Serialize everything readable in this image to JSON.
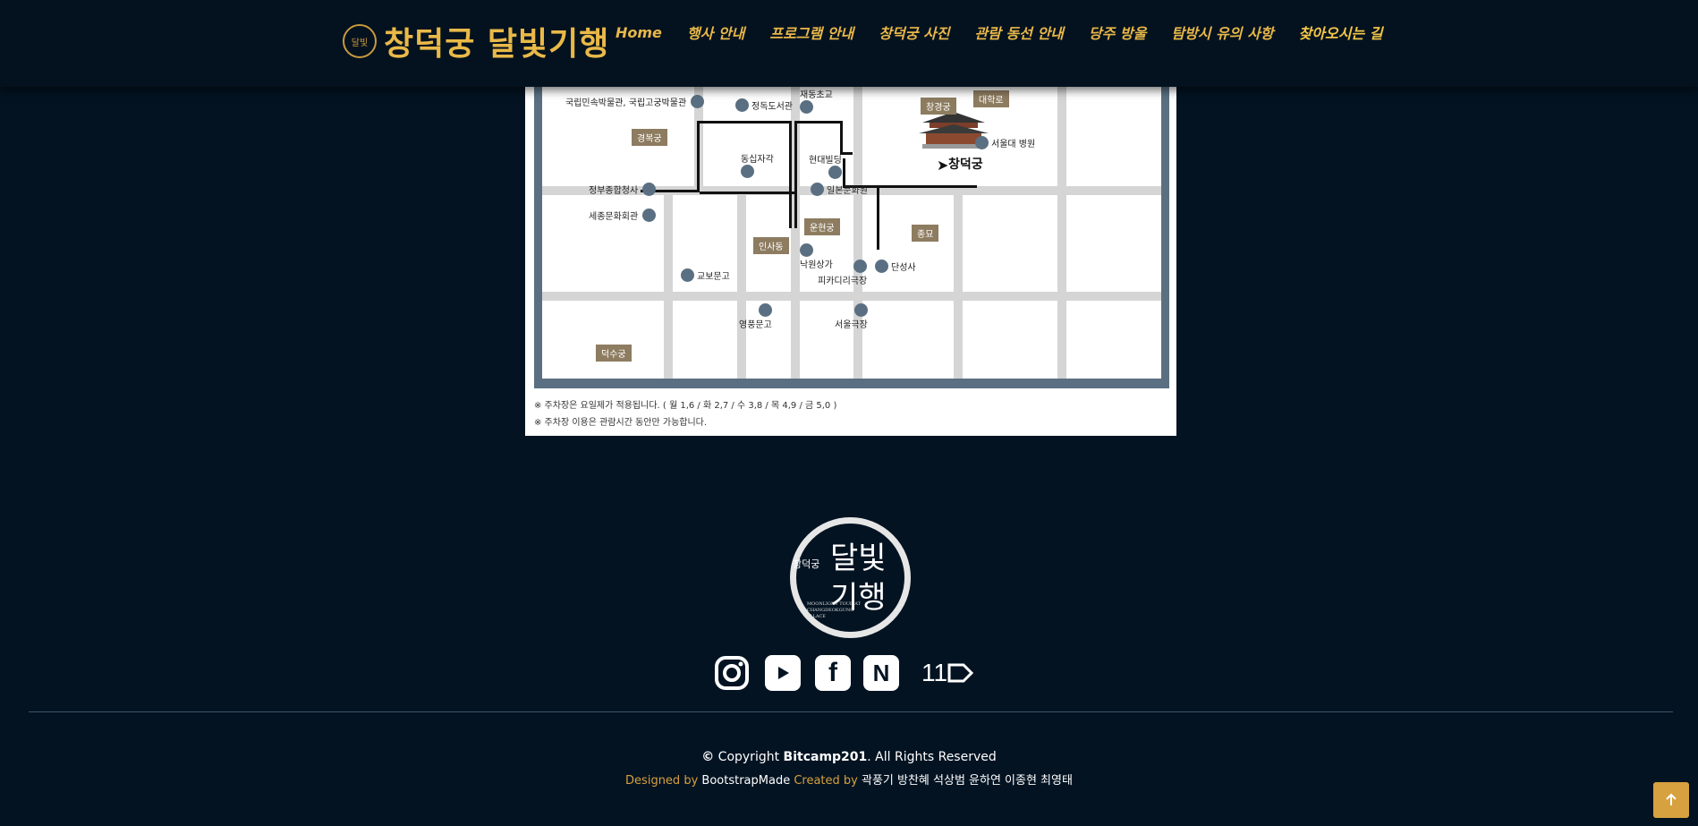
{
  "header": {
    "brand": {
      "emblem": "달빛",
      "name": "창덕궁 달빛기행"
    },
    "nav": [
      {
        "label": "Home"
      },
      {
        "label": "행사 안내"
      },
      {
        "label": "프로그램 안내"
      },
      {
        "label": "창덕궁 사진"
      },
      {
        "label": "관람 동선 안내"
      },
      {
        "label": "당주 방울"
      },
      {
        "label": "탐방시 유의 사항"
      },
      {
        "label": "찾아오시는 길"
      }
    ]
  },
  "map": {
    "tags": {
      "gyeongbokgung": "경복궁",
      "changgyeonggung": "창경궁",
      "daehangno": "대학로",
      "unhyeongung": "운현궁",
      "insadong": "인사동",
      "jongmyo": "종묘",
      "deoksugung": "덕수궁"
    },
    "pois": {
      "folk_museum": "국립민속박물관, 국립고궁박물관",
      "jeongdok_library": "정독도서관",
      "jaedong_school": "재동초교",
      "dongsipjagak": "동십자각",
      "hyundai_building": "현대빌딩",
      "snu_hospital": "서울대 병원",
      "gov_complex": "정부종합청사",
      "ilbon_culture": "일본문화원",
      "sejong_center": "세종문화회관",
      "nakwon_arcade": "낙원상가",
      "piccadilly": "피카디리극장",
      "dansungsa": "단성사",
      "kyobo": "교보문고",
      "youngpoong": "영풍문고",
      "seoul_theater": "서울극장"
    },
    "palace_label": "창덕궁",
    "notes": [
      "※ 주차장은 요일제가 적용됩니다. ( 월 1,6 / 화 2,7 / 수 3,8 / 목 4,9 / 금 5,0 )",
      "※ 주차장 이용은 관람시간 동안만 가능합니다."
    ]
  },
  "footer": {
    "logo": {
      "small": "창덕궁",
      "big1": "달빛",
      "big2": "기행",
      "en": "MOONLIGHT TOUR AT CHANGDEOKGUNG PALACE"
    },
    "social": [
      {
        "icon": "instagram-icon"
      },
      {
        "icon": "youtube-icon"
      },
      {
        "icon": "facebook-icon",
        "glyph": "f"
      },
      {
        "icon": "naver-icon",
        "glyph": "N"
      },
      {
        "icon": "11st-icon",
        "glyph": "11"
      }
    ],
    "copyright_symbol": "©",
    "copyright_text": " Copyright ",
    "copyright_owner": "Bitcamp201",
    "copyright_tail": ". All Rights Reserved",
    "designed_by": "Designed by ",
    "bootstrapmade": "BootstrapMade",
    "created_by": " Created by ",
    "authors": "곽풍기 방찬혜 석상범 윤하연 이종현 최영태"
  },
  "colors": {
    "background": "#031322",
    "gold": "#e8b748",
    "map_frame": "#5a7082",
    "tag": "#8d7c60"
  }
}
